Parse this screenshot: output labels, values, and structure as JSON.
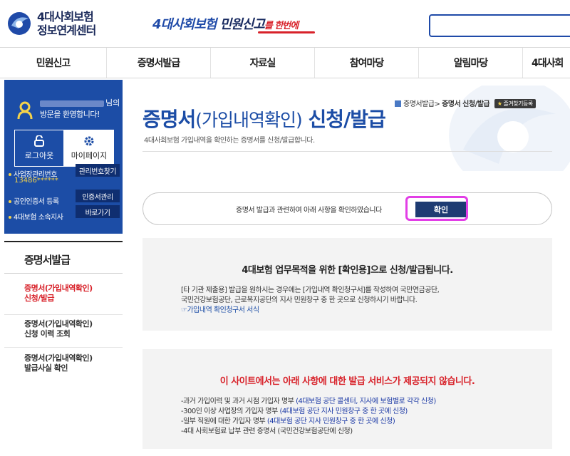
{
  "header": {
    "logo_line1": "4대사회보험",
    "logo_line2": "정보연계센터",
    "slogan_part1": "4대사회보험",
    "slogan_part2": "민원신고",
    "slogan_part3": "를 한번에",
    "search_placeholder": ""
  },
  "nav": {
    "items": [
      "민원신고",
      "증명서발급",
      "자료실",
      "참여마당",
      "알림마당",
      "4대사회"
    ]
  },
  "user": {
    "name_suffix": "님의",
    "welcome": "방문을 환영합니다!",
    "logout_label": "로그아웃",
    "mypage_label": "마이페이지",
    "biz_label": "사업장관리번호",
    "biz_number": "13486******",
    "biz_find_button": "관리번호찾기",
    "cert_label": "공인인증서 등록",
    "cert_button": "인증서관리",
    "branch_label": "4대보험 소속지사",
    "branch_button": "바로가기"
  },
  "sidebar": {
    "title": "증명서발급",
    "items": [
      {
        "line1": "증명서(가입내역확인)",
        "line2": "신청/발급"
      },
      {
        "line1": "증명서(가입내역확인)",
        "line2": "신청 이력 조회"
      },
      {
        "line1": "증명서(가입내역확인)",
        "line2": "발급사실 확인"
      }
    ]
  },
  "breadcrumb": {
    "parent": "증명서발급",
    "separator": ">",
    "current": "증명서 신청/발급",
    "fav_label": "즐겨찾기등록"
  },
  "page": {
    "title_main": "증명서",
    "title_paren": "(가입내역확인)",
    "title_rest": " 신청/발급",
    "subtitle": "4대사회보험 가입내역을 확인하는 증명서를 신청/발급합니다."
  },
  "confirm": {
    "text": "증명서 발급과 관련하여 아래 사항을 확인하였습니다",
    "button": "확인"
  },
  "info": {
    "title": "4대보험 업무목적을 위한 [확인용]으로 신청/발급됩니다.",
    "line1": "[타 기관 제출용] 발급을 원하시는 경우에는 [가입내역 확인청구서]를 작성하여 국민연금공단,",
    "line2": "국민건강보험공단, 근로복지공단의 지사 민원창구 중 한 곳으로 신청하시기 바랍니다.",
    "link": "가입내역 확인청구서 서식"
  },
  "warning": {
    "title": "이 사이트에서는 아래 사항에 대한 발급 서비스가 제공되지 않습니다.",
    "items": [
      {
        "text": "-과거 가입이력 및 과거 시점 가입자 명부 ",
        "note": "(4대보험 공단 콜센터, 지사에 보험별로 각각 신청)"
      },
      {
        "text": "-300인 이상 사업장의 가입자 명부 ",
        "note": "(4대보험 공단 지사 민원창구 중 한 곳에 신청)"
      },
      {
        "text": "-일부 직원에 대한 가입자 명부 ",
        "note": "(4대보험 공단 지사 민원창구 중 한 곳에 신청)"
      },
      {
        "text": "-4대 사회보험료 납부 관련 증명서 (국민건강보험공단에 신청)",
        "note": ""
      }
    ]
  },
  "colors": {
    "brand_blue": "#1c4da6",
    "dark_navy": "#1e3b72",
    "accent_red": "#d8222a",
    "highlight_magenta": "#e23ee6"
  }
}
